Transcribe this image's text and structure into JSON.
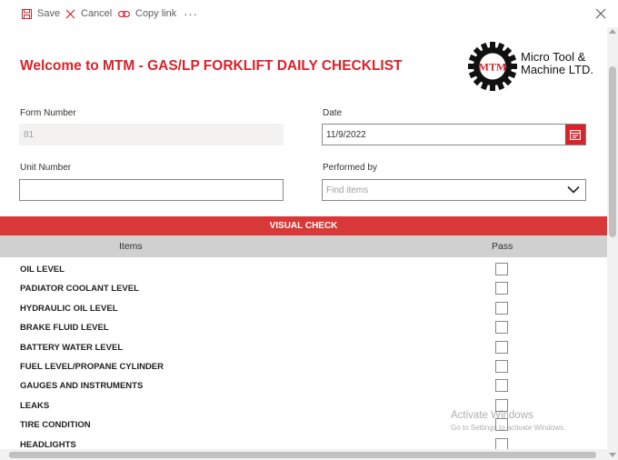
{
  "toolbar": {
    "save": "Save",
    "cancel": "Cancel",
    "copy_link": "Copy link",
    "more": "···"
  },
  "form": {
    "title": "Welcome to MTM - GAS/LP FORKLIFT DAILY CHECKLIST",
    "logo": {
      "mark": "MTM",
      "line1": "Micro Tool &",
      "line2": "Machine LTD."
    },
    "fields": {
      "form_number": {
        "label": "Form Number",
        "value": "81"
      },
      "date": {
        "label": "Date",
        "value": "11/9/2022"
      },
      "unit_number": {
        "label": "Unit Number",
        "value": ""
      },
      "performed_by": {
        "label": "Performed by",
        "placeholder": "Find items"
      }
    },
    "section": "VISUAL CHECK",
    "columns": {
      "items": "Items",
      "pass": "Pass"
    },
    "rows": [
      {
        "label": "OIL LEVEL",
        "checked": false
      },
      {
        "label": "PADIATOR COOLANT LEVEL",
        "checked": false
      },
      {
        "label": "HYDRAULIC OIL LEVEL",
        "checked": false
      },
      {
        "label": "BRAKE FLUID LEVEL",
        "checked": false
      },
      {
        "label": "BATTERY WATER LEVEL",
        "checked": false
      },
      {
        "label": "FUEL LEVEL/PROPANE CYLINDER",
        "checked": false
      },
      {
        "label": "GAUGES AND INSTRUMENTS",
        "checked": false
      },
      {
        "label": "LEAKS",
        "checked": false
      },
      {
        "label": "TIRE CONDITION",
        "checked": false
      },
      {
        "label": "HEADLIGHTS",
        "checked": false
      }
    ]
  },
  "watermark": {
    "line1": "Activate Windows",
    "line2": "Go to Settings to activate Windows."
  },
  "colors": {
    "accent": "#d8232a",
    "section_bar": "#d93838",
    "header_row": "#d0d0d0"
  },
  "icons": {
    "save": "save-icon",
    "cancel": "cancel-icon",
    "copy": "link-icon",
    "close": "close-icon",
    "calendar": "calendar-icon",
    "dropdown": "chevron-down-icon"
  }
}
